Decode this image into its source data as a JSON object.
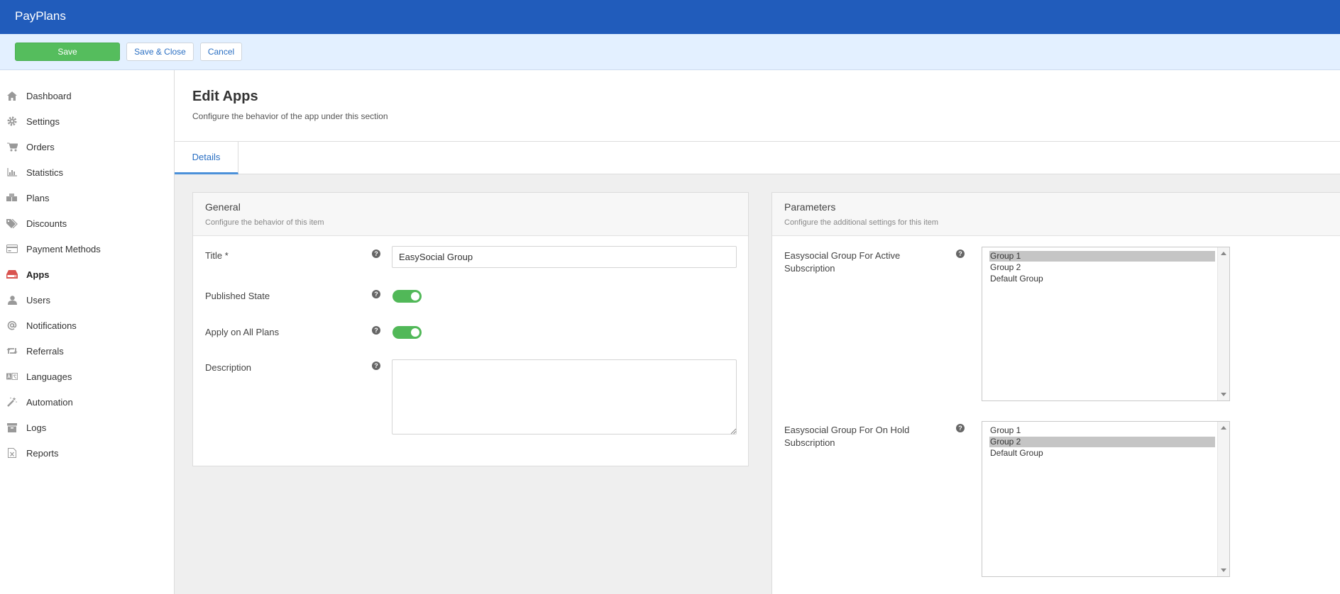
{
  "app": {
    "brand": "PayPlans"
  },
  "toolbar": {
    "save_label": "Save",
    "save_close_label": "Save & Close",
    "cancel_label": "Cancel"
  },
  "sidebar": {
    "items": [
      {
        "label": "Dashboard",
        "icon": "home-icon"
      },
      {
        "label": "Settings",
        "icon": "gear-icon"
      },
      {
        "label": "Orders",
        "icon": "cart-icon"
      },
      {
        "label": "Statistics",
        "icon": "bar-chart-icon"
      },
      {
        "label": "Plans",
        "icon": "cubes-icon"
      },
      {
        "label": "Discounts",
        "icon": "tags-icon"
      },
      {
        "label": "Payment Methods",
        "icon": "credit-card-icon"
      },
      {
        "label": "Apps",
        "icon": "drive-icon",
        "active": true
      },
      {
        "label": "Users",
        "icon": "user-icon"
      },
      {
        "label": "Notifications",
        "icon": "at-icon"
      },
      {
        "label": "Referrals",
        "icon": "retweet-icon"
      },
      {
        "label": "Languages",
        "icon": "language-icon"
      },
      {
        "label": "Automation",
        "icon": "magic-wand-icon"
      },
      {
        "label": "Logs",
        "icon": "archive-icon"
      },
      {
        "label": "Reports",
        "icon": "file-excel-icon"
      }
    ]
  },
  "page": {
    "title": "Edit Apps",
    "subtitle": "Configure the behavior of the app under this section",
    "tabs": [
      {
        "label": "Details",
        "active": true
      }
    ]
  },
  "general": {
    "title": "General",
    "description": "Configure the behavior of this item",
    "title_label": "Title *",
    "title_value": "EasySocial Group",
    "published_label": "Published State",
    "published_on": true,
    "apply_all_label": "Apply on All Plans",
    "apply_all_on": true,
    "description_label": "Description",
    "description_value": ""
  },
  "parameters": {
    "title": "Parameters",
    "description": "Configure the additional settings for this item",
    "active_label": "Easysocial Group For Active Subscription",
    "active_options": [
      "Group 1",
      "Group 2",
      "Default Group"
    ],
    "active_selected": "Group 1",
    "hold_label": "Easysocial Group For On Hold Subscription",
    "hold_options": [
      "Group 1",
      "Group 2",
      "Default Group"
    ],
    "hold_selected": "Group 2"
  },
  "colors": {
    "brand": "#215cbb",
    "save": "#55bd5d",
    "toggle_on": "#51b858",
    "active_icon": "#d9534f"
  }
}
